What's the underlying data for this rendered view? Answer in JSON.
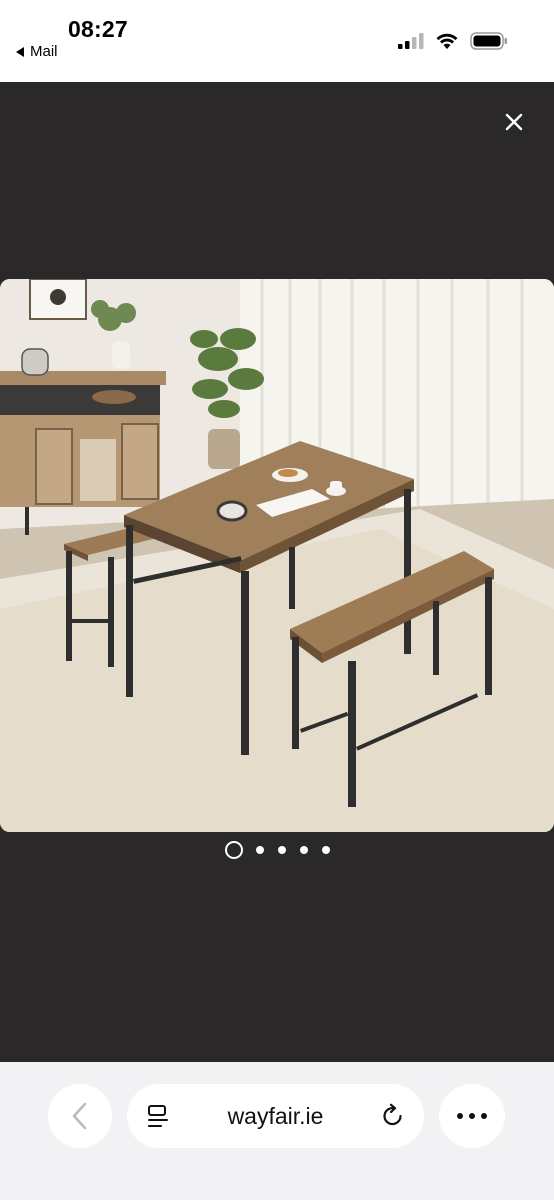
{
  "status_bar": {
    "time": "08:27",
    "back_app": "Mail",
    "icons": [
      "cellular-signal-icon",
      "wifi-icon",
      "battery-icon"
    ]
  },
  "viewer": {
    "background_color": "#2a2829",
    "close_icon": "close-icon",
    "image": "dining table set with two benches in a furnished room",
    "pagination": {
      "total": 5,
      "current": 1
    }
  },
  "browser_bar": {
    "back_icon": "chevron-left-icon",
    "reader_icon": "reader-mode-icon",
    "url": "wayfair.ie",
    "reload_icon": "reload-icon",
    "more_icon": "more-icon"
  }
}
